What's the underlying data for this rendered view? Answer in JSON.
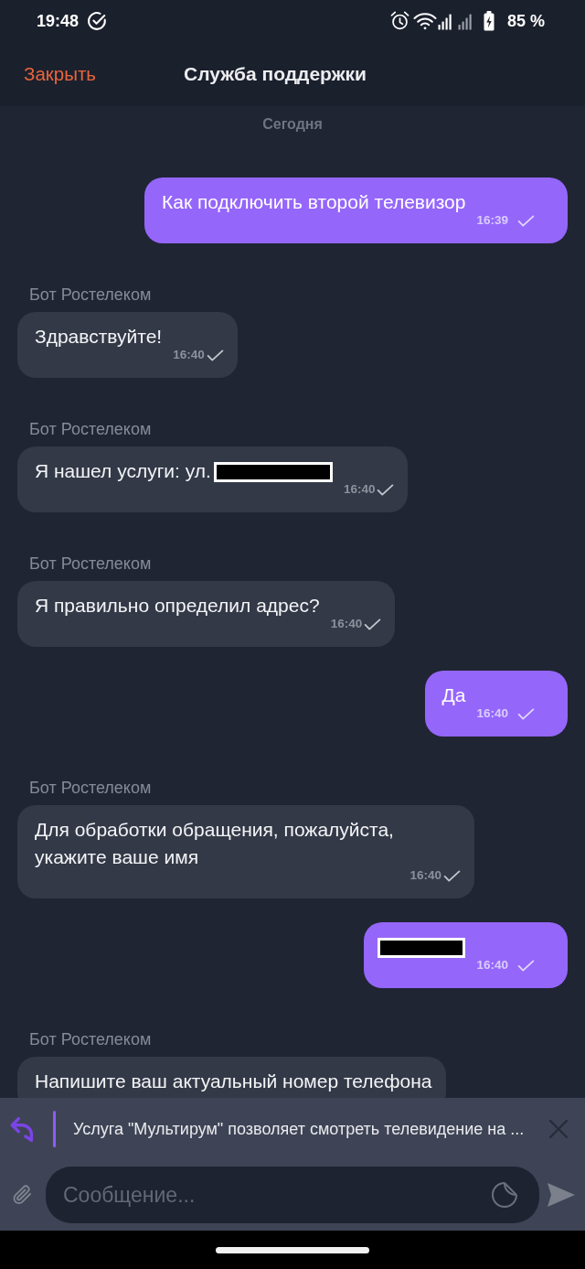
{
  "status_bar": {
    "time": "19:48",
    "battery": "85 %"
  },
  "header": {
    "close": "Закрыть",
    "title": "Служба поддержки"
  },
  "chat": {
    "date": "Сегодня",
    "messages": [
      {
        "kind": "outgoing",
        "text": "Как подключить второй телевизор",
        "redacted": false,
        "time": "16:39"
      },
      {
        "kind": "incoming",
        "sender": "Бот Ростелеком",
        "text": "Здравствуйте!",
        "redacted": false,
        "time": "16:40"
      },
      {
        "kind": "incoming",
        "sender": "Бот Ростелеком",
        "text": "Я нашел услуги: ул.",
        "redacted": true,
        "time": "16:40"
      },
      {
        "kind": "incoming",
        "sender": "Бот Ростелеком",
        "text": "Я правильно определил адрес?",
        "redacted": false,
        "time": "16:40"
      },
      {
        "kind": "outgoing",
        "text": "Да",
        "redacted": false,
        "time": "16:40"
      },
      {
        "kind": "incoming",
        "sender": "Бот Ростелеком",
        "text": "Для обработки обращения, пожалуйста, укажите ваше имя",
        "redacted": false,
        "time": "16:40"
      },
      {
        "kind": "outgoing",
        "redacted": true,
        "time": "16:40"
      },
      {
        "kind": "incoming",
        "sender": "Бот Ростелеком",
        "text": "Напишите ваш актуальный номер телефона",
        "redacted": false
      }
    ]
  },
  "reply_preview": {
    "text": "Услуга \"Мультирум\" позволяет смотреть телевидение на ..."
  },
  "composer": {
    "placeholder": "Сообщение..."
  }
}
